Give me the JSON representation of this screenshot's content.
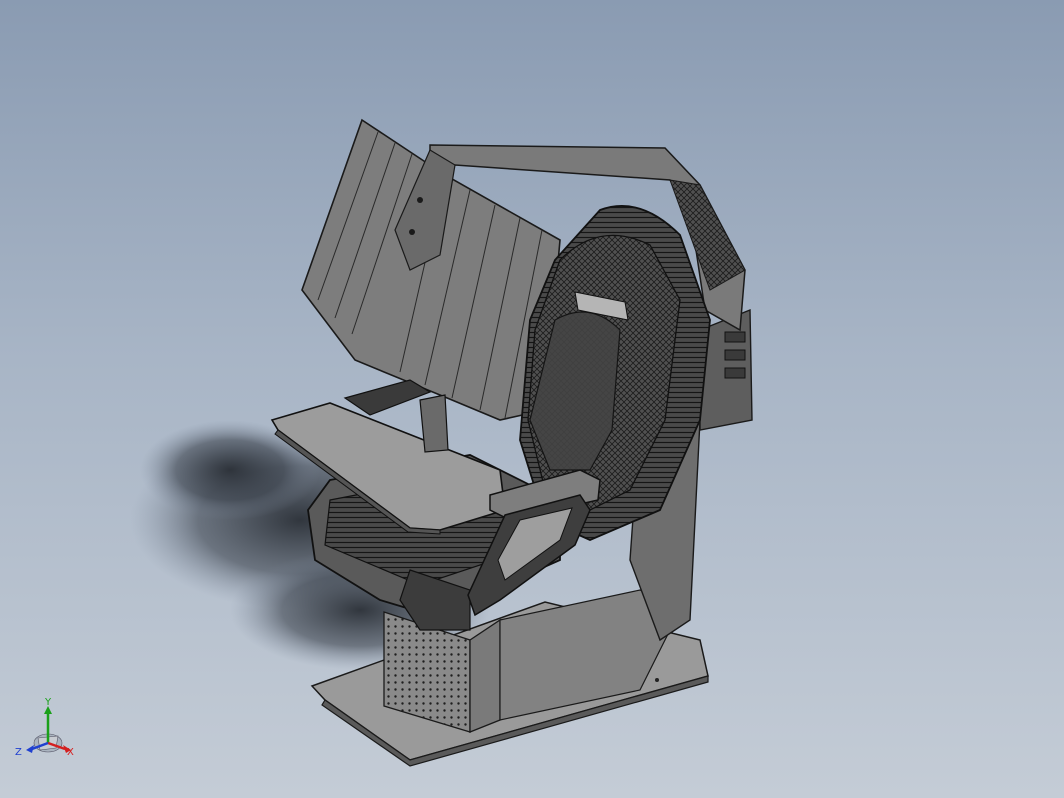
{
  "viewport": {
    "background_top": "#8a9bb2",
    "background_bottom": "#c4ccd6",
    "model_fill": "#6f6f6f",
    "model_edge": "#1a1a1a"
  },
  "triad": {
    "x_label": "X",
    "y_label": "Y",
    "z_label": "Z",
    "x_color": "#d42020",
    "y_color": "#1aa01a",
    "z_color": "#2040d0"
  }
}
